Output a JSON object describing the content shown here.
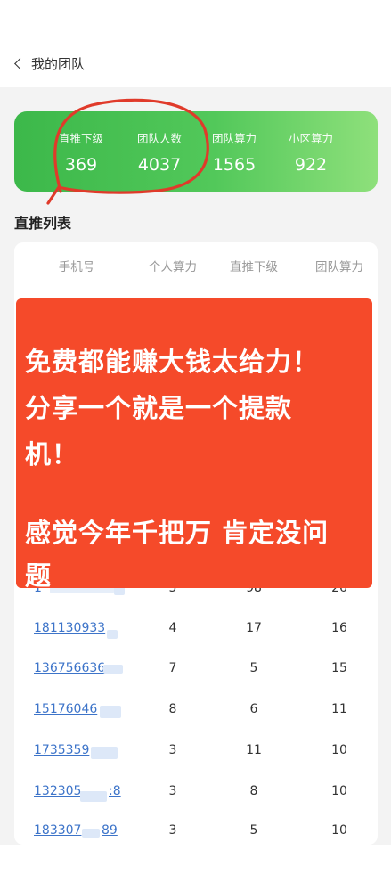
{
  "header": {
    "back_label": "我的团队"
  },
  "stats": [
    {
      "label": "直推下级",
      "value": "369"
    },
    {
      "label": "团队人数",
      "value": "4037"
    },
    {
      "label": "团队算力",
      "value": "1565"
    },
    {
      "label": "小区算力",
      "value": "922"
    }
  ],
  "list_title": "直推列表",
  "table": {
    "headers": [
      "手机号",
      "个人算力",
      "直推下级",
      "团队算力"
    ],
    "rows": [
      {
        "phone": "1",
        "personal": "5",
        "direct": "98",
        "team": "26"
      },
      {
        "phone": "181130933",
        "personal": "4",
        "direct": "17",
        "team": "16"
      },
      {
        "phone": "136756636",
        "personal": "7",
        "direct": "5",
        "team": "15"
      },
      {
        "phone": "15176046",
        "personal": "8",
        "direct": "6",
        "team": "11"
      },
      {
        "phone": "1735359",
        "personal": "3",
        "direct": "11",
        "team": "10"
      },
      {
        "phone": "132305",
        "personal": "3",
        "direct": "8",
        "team": "10"
      },
      {
        "phone": "183307",
        "personal": "3",
        "direct": "5",
        "team": "10"
      }
    ],
    "row_tail": [
      "",
      "",
      "",
      "",
      "",
      ":8",
      "89"
    ]
  },
  "overlay": {
    "lines": [
      "免费都能赚大钱太给力！",
      "分享一个就是一个提款",
      "机！",
      "感觉今年千把万 肯定没问",
      "题"
    ]
  },
  "colors": {
    "accent_green": "#3cb84a",
    "overlay_red": "#f54a2a",
    "link_blue": "#3d74c9",
    "annotation_red": "#e03a2a"
  }
}
